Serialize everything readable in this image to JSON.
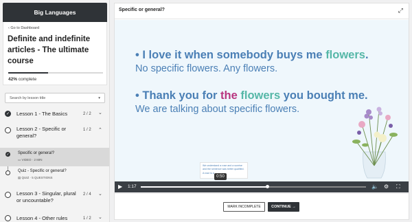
{
  "app": {
    "brand": "Big Languages"
  },
  "course": {
    "back_label": "‹ Go to Dashboard",
    "title": "Definite and indefinite articles - The ultimate course",
    "progress_fraction": 0.42,
    "progress_percent": "42%",
    "progress_suffix": " complete"
  },
  "search": {
    "placeholder": "Search by lesson title",
    "chevron": "▾"
  },
  "lessons": [
    {
      "title": "Lesson 1 - The Basics",
      "count": "2 / 2",
      "chevron": "⌄",
      "complete": true
    },
    {
      "title": "Lesson 2 - Specific or general?",
      "count": "1 / 2",
      "chevron": "⌃",
      "complete": false
    },
    {
      "title": "Lesson 3 - Singular, plural or uncountable?",
      "count": "2 / 4",
      "chevron": "⌄",
      "complete": false
    },
    {
      "title": "Lesson 4 - Other rules",
      "count": "1 / 2",
      "chevron": "⌄",
      "complete": false
    }
  ],
  "sublessons": [
    {
      "title": "Specific or general?",
      "meta": "VIDEO · 2 MIN",
      "active": true
    },
    {
      "title": "Quiz - Specific or general?",
      "meta": "QUIZ · 5 QUESTIONS",
      "active": false
    }
  ],
  "main": {
    "title": "Specific or general?"
  },
  "slide": {
    "l1_a": "• I love it when somebody buys me ",
    "l1_b": "flowers",
    "l1_c": ".",
    "l2": "No specific flowers. Any flowers.",
    "l3_a": "• Thank you for ",
    "l3_b": "the",
    "l3_c": " ",
    "l3_d": "flowers",
    "l3_e": " you bought me.",
    "l4": "We are talking about specific flowers."
  },
  "player": {
    "current_time": "1:17",
    "hover_time": "0:50",
    "played_fraction": 0.56,
    "thumb_text_1": "We understand a rose and a sunrise",
    "thumb_text_2": "and the sentence was better qualified.",
    "thumb_text_3": "A rose is a"
  },
  "footer": {
    "incomplete_label": "MARK INCOMPLETE",
    "continue_label": "CONTINUE →"
  },
  "colors": {
    "accent_dark": "#2f3337",
    "slide_blue": "#4a7fb5",
    "teal": "#55b7a7",
    "pink": "#b8357f"
  }
}
